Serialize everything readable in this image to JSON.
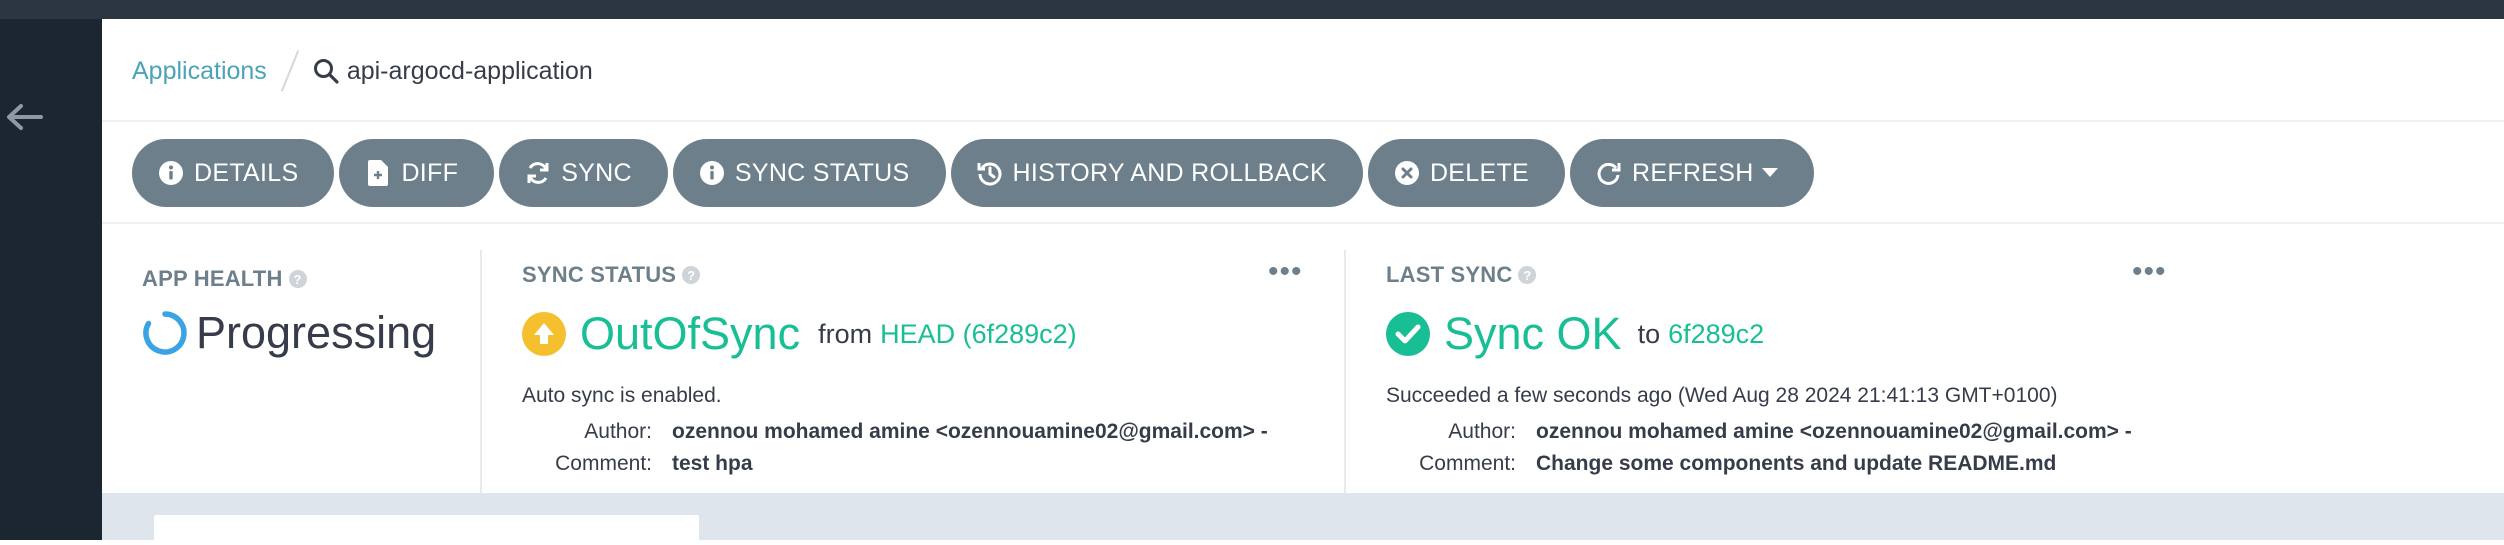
{
  "breadcrumb": {
    "root": "Applications",
    "current": "api-argocd-application"
  },
  "toolbar": {
    "buttons": [
      {
        "label": "DETAILS",
        "icon": "info-circle-icon"
      },
      {
        "label": "DIFF",
        "icon": "file-diff-icon"
      },
      {
        "label": "SYNC",
        "icon": "sync-icon"
      },
      {
        "label": "SYNC STATUS",
        "icon": "info-circle-icon"
      },
      {
        "label": "HISTORY AND ROLLBACK",
        "icon": "history-icon"
      },
      {
        "label": "DELETE",
        "icon": "times-circle-icon"
      },
      {
        "label": "REFRESH",
        "icon": "redo-icon"
      }
    ]
  },
  "app_health": {
    "label": "APP HEALTH",
    "status": "Progressing",
    "color": "#3aa3e3"
  },
  "sync_status": {
    "label": "SYNC STATUS",
    "status": "OutOfSync",
    "from_text": "from",
    "revision": "HEAD (6f289c2)",
    "auto_sync": "Auto sync is enabled.",
    "author_label": "Author:",
    "author": "ozennou mohamed amine <ozennouamine02@gmail.com> -",
    "comment_label": "Comment:",
    "comment": "test hpa",
    "status_color": "#18be94",
    "icon_color": "#f4c030"
  },
  "last_sync": {
    "label": "LAST SYNC",
    "status": "Sync OK",
    "to_text": "to",
    "revision": "6f289c2",
    "succeeded": "Succeeded a few seconds ago (Wed Aug 28 2024 21:41:13 GMT+0100)",
    "author_label": "Author:",
    "author": "ozennou mohamed amine <ozennouamine02@gmail.com> -",
    "comment_label": "Comment:",
    "comment": "Change some components and update README.md",
    "status_color": "#18be94"
  }
}
